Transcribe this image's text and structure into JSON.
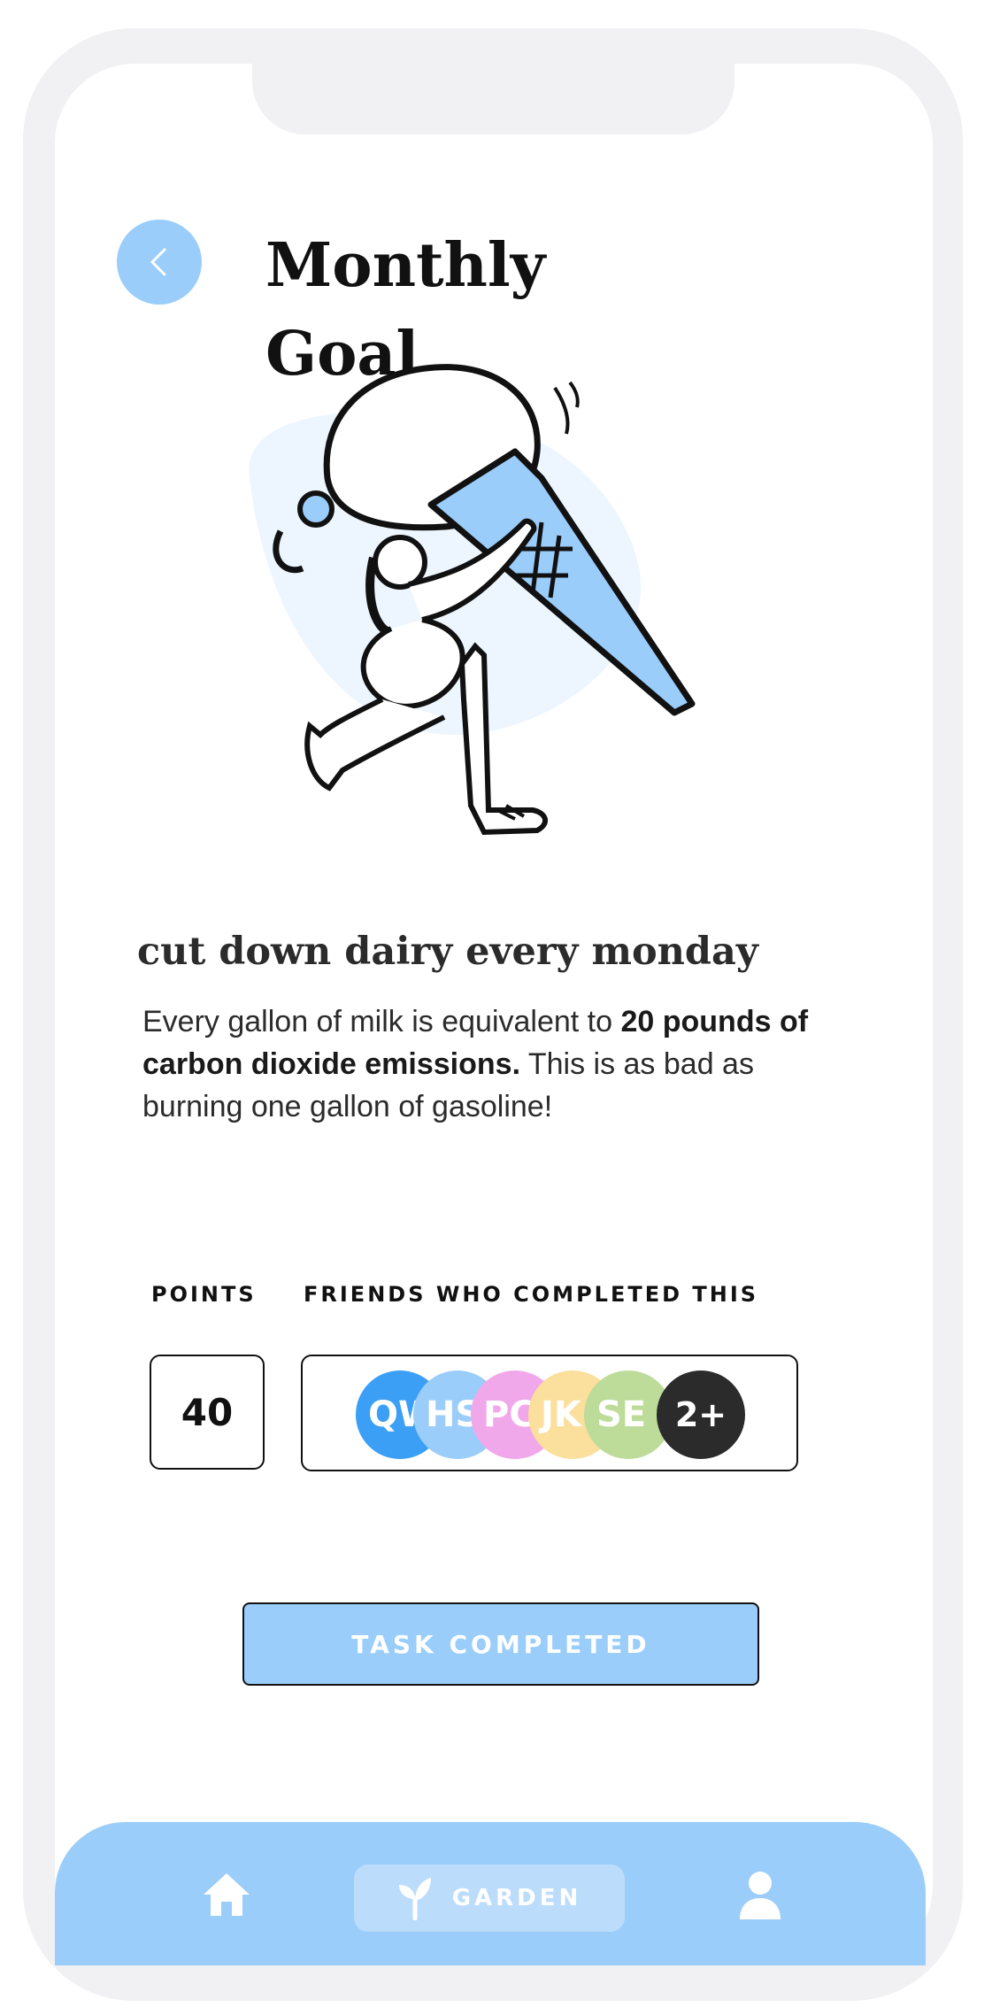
{
  "header": {
    "title": "Monthly Goal",
    "back_icon": "chevron-left-icon"
  },
  "illustration": {
    "subject": "woman carrying a giant ice cream cone"
  },
  "goal": {
    "title": "cut down dairy every monday",
    "desc_part1": "Every gallon of milk is equivalent to ",
    "desc_bold": "20 pounds of carbon dioxide emissions.",
    "desc_part2": " This is as bad as burning one gallon of gasoline!"
  },
  "stats": {
    "points_label": "POINTS",
    "points_value": "40",
    "friends_label": "FRIENDS WHO COMPLETED THIS",
    "friends": [
      {
        "initials": "QW",
        "color": "#3b9ff5"
      },
      {
        "initials": "HS",
        "color": "#9bcdfa"
      },
      {
        "initials": "PC",
        "color": "#f0a8ea"
      },
      {
        "initials": "JK",
        "color": "#fbdf9c"
      },
      {
        "initials": "SE",
        "color": "#bddc99"
      }
    ],
    "more": {
      "label": "2+",
      "color": "#2b2b2b"
    }
  },
  "actions": {
    "task_button": "TASK COMPLETED"
  },
  "nav": {
    "home_icon": "home-icon",
    "garden_icon": "sprout-icon",
    "garden_label": "GARDEN",
    "profile_icon": "user-icon"
  },
  "colors": {
    "accent": "#9bcdfa",
    "accent_light": "#bcdcfb",
    "blob": "#edf6ff",
    "text": "#2b2b2b"
  }
}
